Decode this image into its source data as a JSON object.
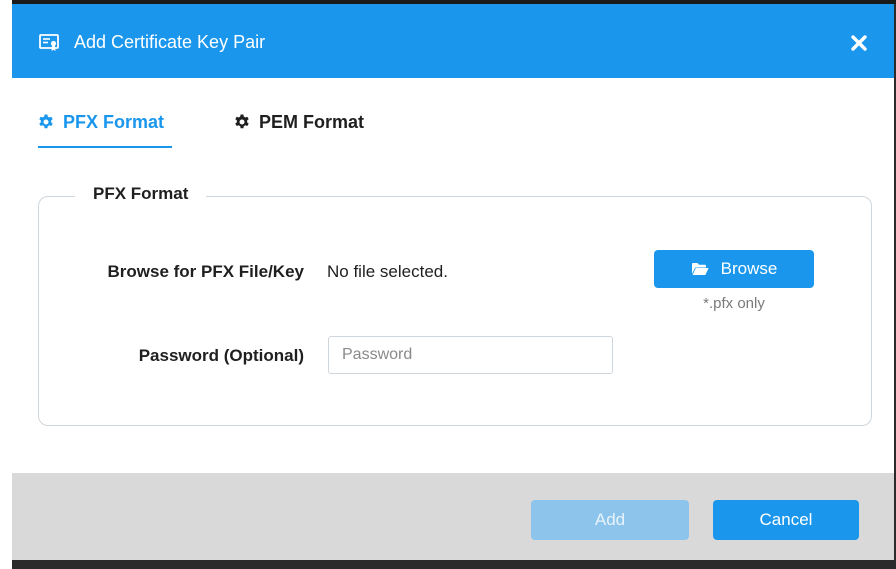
{
  "dialog": {
    "title": "Add Certificate Key Pair",
    "title_icon": "certificate-icon",
    "close_icon": "close-icon"
  },
  "tabs": [
    {
      "label": "PFX Format",
      "icon": "gear-icon",
      "active": true
    },
    {
      "label": "PEM Format",
      "icon": "gear-icon",
      "active": false
    }
  ],
  "pfx_section": {
    "legend": "PFX Format",
    "browse_label": "Browse for PFX File/Key",
    "file_status": "No file selected.",
    "browse_button": "Browse",
    "browse_icon": "folder-open-icon",
    "file_hint": "*.pfx only",
    "password_label": "Password (Optional)",
    "password_placeholder": "Password",
    "password_value": ""
  },
  "footer": {
    "add_label": "Add",
    "add_enabled": false,
    "cancel_label": "Cancel"
  },
  "colors": {
    "accent": "#1a97ec",
    "accent_disabled": "#8cc4ec",
    "footer_bg": "#d9d9d9",
    "border": "#cfd6dc"
  }
}
